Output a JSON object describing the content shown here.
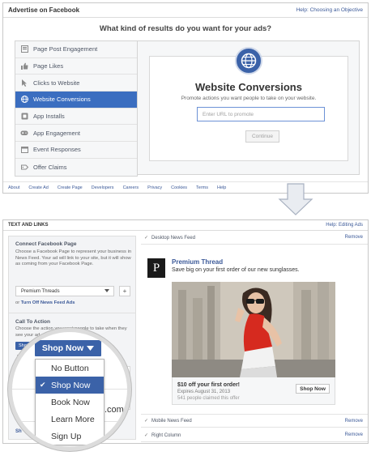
{
  "top": {
    "title": "Advertise on Facebook",
    "help_link": "Help: Choosing an Objective",
    "question": "What kind of results do you want for your ads?",
    "objectives": [
      {
        "label": "Page Post Engagement",
        "icon": "post-icon"
      },
      {
        "label": "Page Likes",
        "icon": "thumb-up-icon"
      },
      {
        "label": "Clicks to Website",
        "icon": "cursor-icon"
      },
      {
        "label": "Website Conversions",
        "icon": "globe-icon",
        "selected": true
      },
      {
        "label": "App Installs",
        "icon": "app-icon"
      },
      {
        "label": "App Engagement",
        "icon": "gamepad-icon"
      },
      {
        "label": "Event Responses",
        "icon": "calendar-icon"
      },
      {
        "label": "Offer Claims",
        "icon": "offer-icon"
      }
    ],
    "detail": {
      "heading": "Website Conversions",
      "description": "Promote actions you want people to take on your website.",
      "url_placeholder": "Enter URL to promote",
      "continue_label": "Continue"
    },
    "footer_links": [
      "About",
      "Create Ad",
      "Create Page",
      "Developers",
      "Careers",
      "Privacy",
      "Cookies",
      "Terms",
      "Help"
    ]
  },
  "bottom": {
    "title": "TEXT AND LINKS",
    "help_link": "Help: Editing Ads",
    "connect": {
      "title": "Connect Facebook Page",
      "text": "Choose a Facebook Page to represent your business in News Feed. Your ad will link to your site, but it will show as coming from your Facebook Page.",
      "selected_page": "Premium Threads",
      "turn_off_prefix": "or",
      "turn_off_link": "Turn Off News Feed Ads"
    },
    "cta": {
      "title": "Call To Action",
      "text": "Choose the action you want people to take when they see your ad.",
      "button_label": "Shop Now"
    },
    "placements": {
      "desktop": "Desktop News Feed",
      "mobile": "Mobile News Feed",
      "right": "Right Column",
      "remove": "Remove"
    },
    "ad": {
      "logo_letter": "P",
      "page_name": "Premium Thread",
      "text": "Save big on your first order of our new sunglasses.",
      "offer_title": "$10 off your first order!",
      "expires": "Expires August 31, 2013",
      "claimed": "541 people claimed this offer",
      "cta_label": "Shop Now"
    },
    "magnifier": {
      "button_label": "Shop Now",
      "options": [
        "No Button",
        "Shop Now",
        "Book Now",
        "Learn More",
        "Sign Up"
      ],
      "selected": "Shop Now",
      "partial_text": ".com"
    },
    "partial_labels": {
      "no": "No",
      "sh": "Sh"
    }
  },
  "colors": {
    "facebook_blue": "#3b5998",
    "selected_blue": "#3b6ec0",
    "button_blue": "#3b62a8"
  }
}
